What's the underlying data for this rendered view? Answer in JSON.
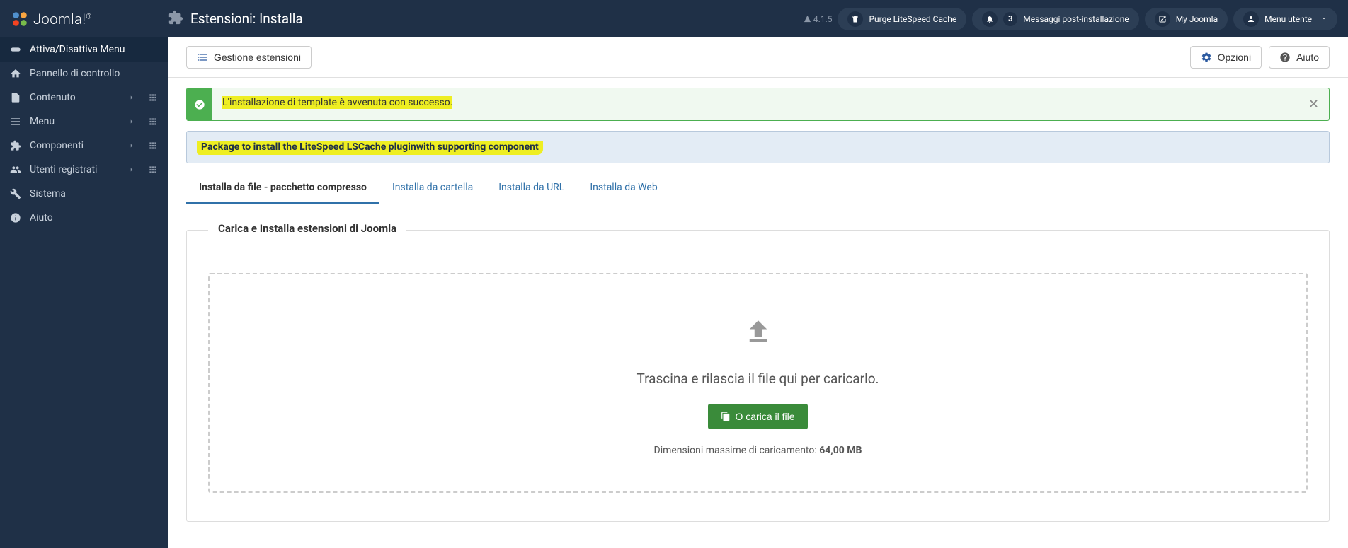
{
  "brand": {
    "name": "Joomla!",
    "version": "4.1.5"
  },
  "header": {
    "title": "Estensioni: Installa",
    "purge_label": "Purge LiteSpeed Cache",
    "notification_count": "3",
    "post_install_label": "Messaggi post-installazione",
    "my_site_label": "My Joomla",
    "user_menu_label": "Menu utente"
  },
  "sidebar": {
    "items": [
      {
        "label": "Attiva/Disattiva Menu"
      },
      {
        "label": "Pannello di controllo"
      },
      {
        "label": "Contenuto"
      },
      {
        "label": "Menu"
      },
      {
        "label": "Componenti"
      },
      {
        "label": "Utenti registrati"
      },
      {
        "label": "Sistema"
      },
      {
        "label": "Aiuto"
      }
    ]
  },
  "toolbar": {
    "manage_label": "Gestione estensioni",
    "options_label": "Opzioni",
    "help_label": "Aiuto"
  },
  "alerts": {
    "success": "L'installazione di template è avvenuta con successo.",
    "info": "Package to install the LiteSpeed LSCache pluginwith supporting component"
  },
  "tabs": [
    {
      "label": "Installa da file - pacchetto compresso",
      "active": true
    },
    {
      "label": "Installa da cartella"
    },
    {
      "label": "Installa da URL"
    },
    {
      "label": "Installa da Web"
    }
  ],
  "upload": {
    "legend": "Carica e Installa estensioni di Joomla",
    "drop_text": "Trascina e rilascia il file qui per caricarlo.",
    "button_label": "O carica il file",
    "max_size_label": "Dimensioni massime di caricamento: ",
    "max_size_value": "64,00 MB"
  }
}
